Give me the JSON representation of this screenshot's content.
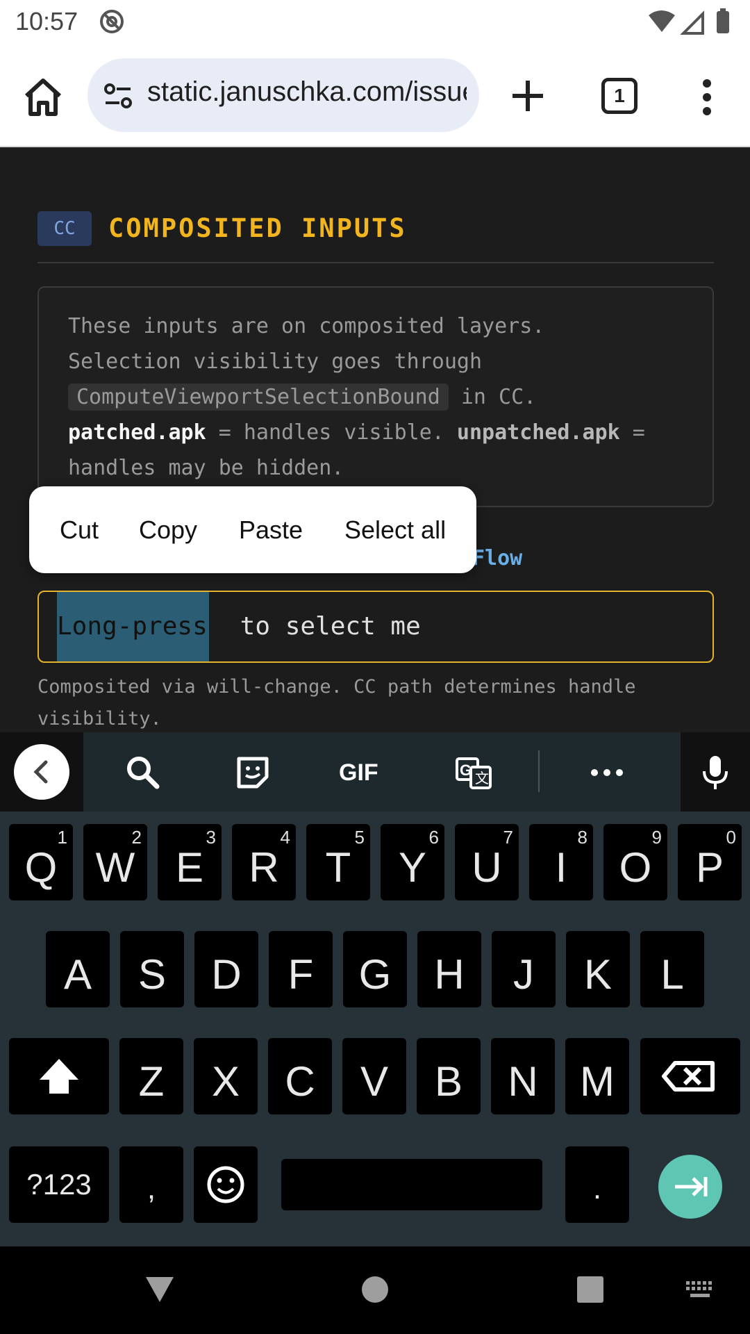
{
  "status_bar": {
    "time": "10:57"
  },
  "browser": {
    "url": "static.januschka.com/issue",
    "tab_count": "1"
  },
  "page": {
    "badge": "CC",
    "title": "COMPOSITED INPUTS",
    "info": {
      "line1": "These inputs are on composited layers.",
      "line2": "Selection visibility goes through",
      "code": "ComputeViewportSelectionBound",
      "line3_tail": " in CC.",
      "patched": "patched.apk",
      "patched_tail": " = handles visible. ",
      "unpatched": "unpatched.apk",
      "unpatched_tail": " =",
      "line5": "handles may be hidden."
    },
    "partial_link": "Flow",
    "input": {
      "selected_text": "Long-press",
      "rest_text": " to select me"
    },
    "caption": "Composited via will-change. CC path determines handle visibility."
  },
  "context_menu": {
    "cut": "Cut",
    "copy": "Copy",
    "paste": "Paste",
    "select_all": "Select all"
  },
  "keyboard": {
    "toolbar_icons": [
      "chevron-left-icon",
      "search-icon",
      "sticker-icon",
      "gif-icon",
      "translate-icon",
      "more-icon",
      "mic-icon"
    ],
    "gif_label": "GIF",
    "row1": [
      {
        "k": "Q",
        "h": "1"
      },
      {
        "k": "W",
        "h": "2"
      },
      {
        "k": "E",
        "h": "3"
      },
      {
        "k": "R",
        "h": "4"
      },
      {
        "k": "T",
        "h": "5"
      },
      {
        "k": "Y",
        "h": "6"
      },
      {
        "k": "U",
        "h": "7"
      },
      {
        "k": "I",
        "h": "8"
      },
      {
        "k": "O",
        "h": "9"
      },
      {
        "k": "P",
        "h": "0"
      }
    ],
    "row2": [
      "A",
      "S",
      "D",
      "F",
      "G",
      "H",
      "J",
      "K",
      "L"
    ],
    "row3": [
      "Z",
      "X",
      "C",
      "V",
      "B",
      "N",
      "M"
    ],
    "symbols_label": "?123",
    "comma_label": ",",
    "period_label": "."
  },
  "colors": {
    "accent_yellow": "#f2b51e",
    "selection": "#2b5e74",
    "enter_key": "#5ec6b3",
    "link": "#6aaee8"
  }
}
